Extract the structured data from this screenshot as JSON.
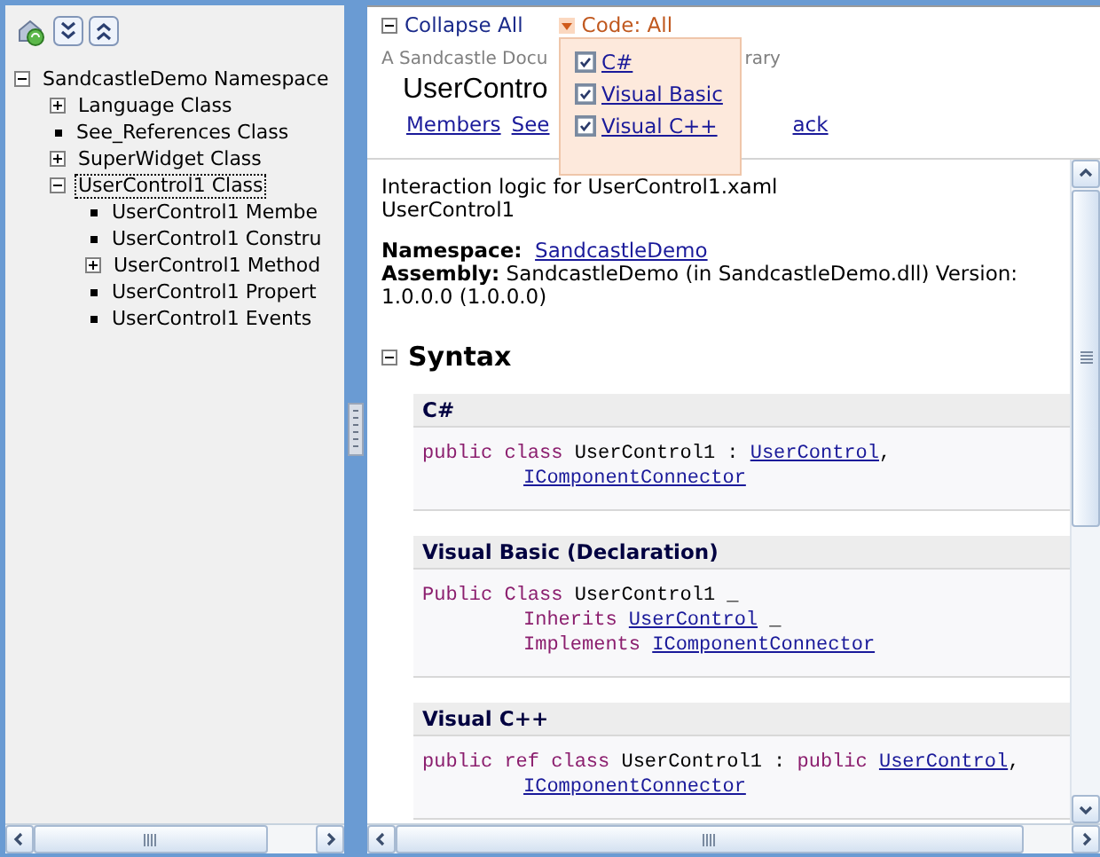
{
  "tree": [
    {
      "label": "SandcastleDemo Namespace",
      "kind": "expandable",
      "expanded": true,
      "selected": false,
      "children": [
        {
          "label": "Language Class",
          "kind": "expandable",
          "expanded": false,
          "selected": false
        },
        {
          "label": "See_References Class",
          "kind": "leaf",
          "selected": false
        },
        {
          "label": "SuperWidget Class",
          "kind": "expandable",
          "expanded": false,
          "selected": false
        },
        {
          "label": "UserControl1 Class",
          "kind": "expandable",
          "expanded": true,
          "selected": true,
          "children": [
            {
              "label": "UserControl1 Membe",
              "kind": "leaf",
              "selected": false
            },
            {
              "label": "UserControl1 Constru",
              "kind": "leaf",
              "selected": false
            },
            {
              "label": "UserControl1 Method",
              "kind": "expandable",
              "expanded": false,
              "selected": false
            },
            {
              "label": "UserControl1 Propert",
              "kind": "leaf",
              "selected": false
            },
            {
              "label": "UserControl1 Events",
              "kind": "leaf",
              "selected": false
            }
          ]
        }
      ]
    }
  ],
  "header": {
    "collapse_all": "Collapse All",
    "code_filter": "Code: All",
    "code_menu": [
      {
        "label": "C#",
        "checked": true
      },
      {
        "label": "Visual Basic",
        "checked": true
      },
      {
        "label": "Visual C++",
        "checked": true
      }
    ],
    "subtitle_parts": [
      "A Sandcastle Docu",
      "rary"
    ],
    "title": "UserContro",
    "links": [
      "Members",
      "See",
      "ack"
    ]
  },
  "summary": [
    "Interaction logic for UserControl1.xaml",
    "UserControl1"
  ],
  "namespace": {
    "label": "Namespace:",
    "link": "SandcastleDemo"
  },
  "assembly": "**Assembly:**  SandcastleDemo (in SandcastleDemo.dll) Version: 1.0.0.0 (1.0.0.0)",
  "section": {
    "title": "Syntax",
    "expanded": true
  },
  "syntax_blocks": [
    {
      "language": "C#",
      "lines": [
        {
          "indent": false,
          "tokens": [
            {
              "kind": "keyword",
              "text": "public class "
            },
            {
              "kind": "plain",
              "text": "UserControl1 : "
            },
            {
              "kind": "link",
              "text": "UserControl"
            },
            {
              "kind": "plain",
              "text": ","
            }
          ]
        },
        {
          "indent": true,
          "tokens": [
            {
              "kind": "link",
              "text": "IComponentConnector"
            }
          ]
        }
      ]
    },
    {
      "language": "Visual Basic (Declaration)",
      "lines": [
        {
          "indent": false,
          "tokens": [
            {
              "kind": "keyword",
              "text": "Public Class "
            },
            {
              "kind": "plain",
              "text": "UserControl1 _"
            }
          ]
        },
        {
          "indent": true,
          "tokens": [
            {
              "kind": "keyword",
              "text": "Inherits "
            },
            {
              "kind": "link",
              "text": "UserControl"
            },
            {
              "kind": "plain",
              "text": " _"
            }
          ]
        },
        {
          "indent": true,
          "tokens": [
            {
              "kind": "keyword",
              "text": "Implements "
            },
            {
              "kind": "link",
              "text": "IComponentConnector"
            }
          ]
        }
      ]
    },
    {
      "language": "Visual C++",
      "lines": [
        {
          "indent": false,
          "tokens": [
            {
              "kind": "keyword",
              "text": "public ref class "
            },
            {
              "kind": "plain",
              "text": "UserControl1 : "
            },
            {
              "kind": "keyword",
              "text": "public "
            },
            {
              "kind": "link",
              "text": "UserControl"
            },
            {
              "kind": "plain",
              "text": ","
            }
          ]
        },
        {
          "indent": true,
          "tokens": [
            {
              "kind": "link",
              "text": "IComponentConnector"
            }
          ]
        }
      ]
    }
  ]
}
